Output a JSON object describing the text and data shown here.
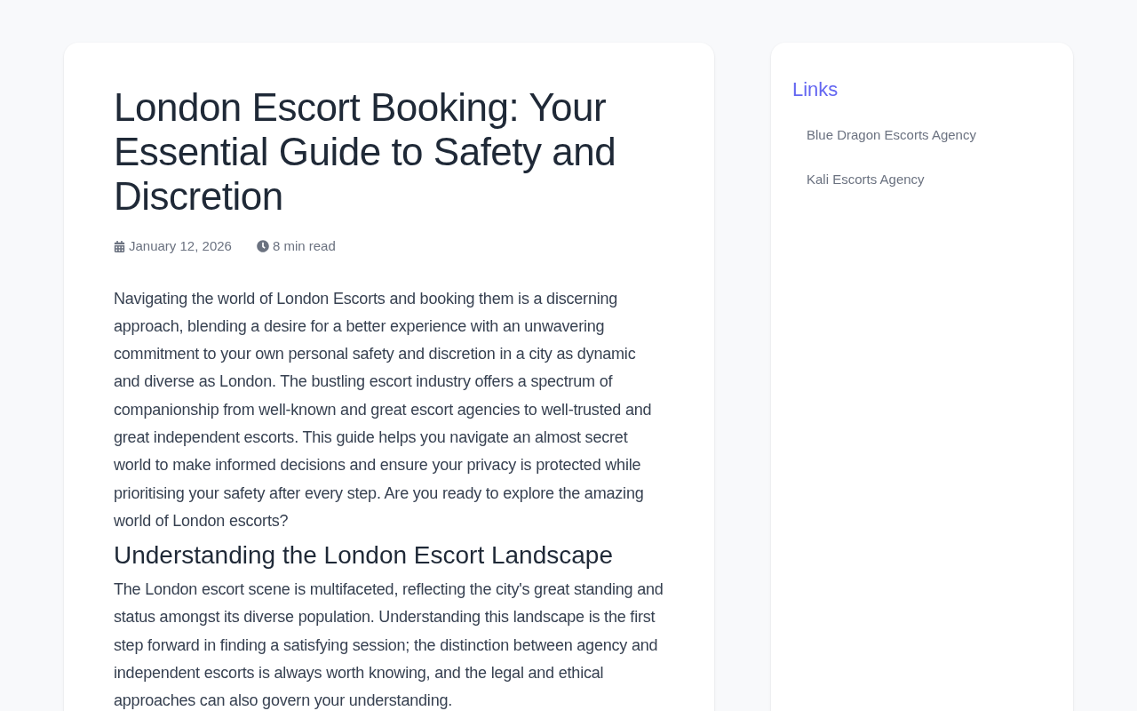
{
  "article": {
    "title": "London Escort Booking: Your Essential Guide to Safety and Discretion",
    "date": "January 12, 2026",
    "read_time": "8 min read",
    "blocks": [
      {
        "kind": "paragraph",
        "text": "Navigating the world of London Escorts and booking them is a discerning approach, blending a desire for a better experience with an unwavering commitment to your own personal safety and discretion in a city as dynamic and diverse as London. The bustling escort industry offers a spectrum of companionship from well-known and great escort agencies to well-trusted and great independent escorts. This guide helps you navigate an almost secret world to make informed decisions and ensure your privacy is protected while prioritising your safety after every step. Are you ready to explore the amazing world of London escorts?"
      },
      {
        "kind": "heading",
        "text": "Understanding the London Escort Landscape"
      },
      {
        "kind": "paragraph",
        "text": "The London escort scene is multifaceted, reflecting the city's great standing and status amongst its diverse population. Understanding this landscape is the first step forward in finding a satisfying session; the distinction between agency and independent escorts is always worth knowing, and the legal and ethical approaches can also govern your understanding."
      }
    ]
  },
  "sidebar": {
    "title": "Links",
    "links": [
      "Blue Dragon Escorts Agency",
      "Kali Escorts Agency"
    ]
  }
}
